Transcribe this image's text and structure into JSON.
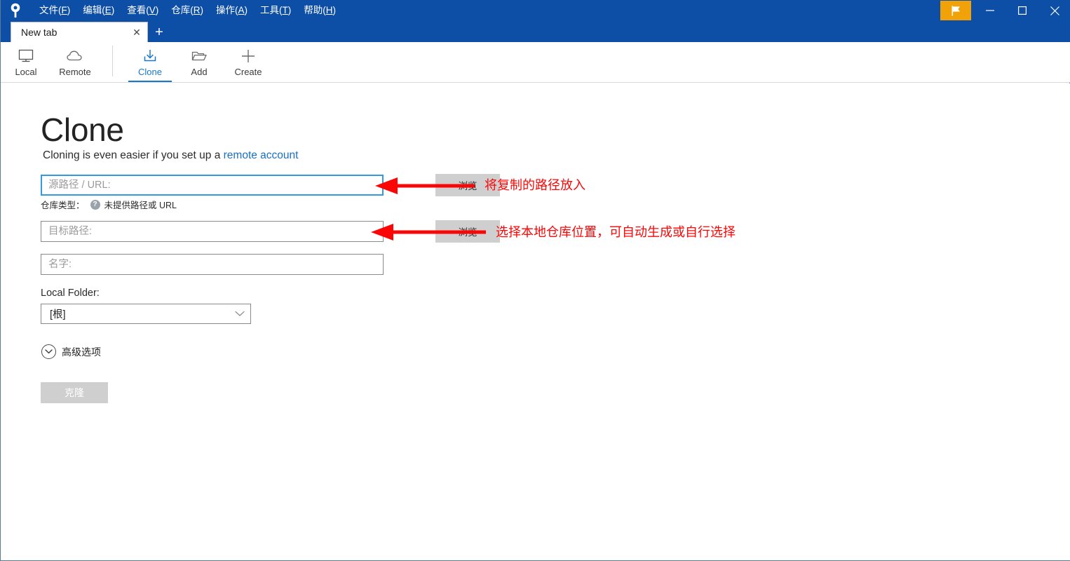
{
  "window": {
    "logo_icon": "sourcetree-logo-icon",
    "menus": [
      {
        "label": "文件",
        "accel": "F"
      },
      {
        "label": "编辑",
        "accel": "E"
      },
      {
        "label": "查看",
        "accel": "V"
      },
      {
        "label": "仓库",
        "accel": "R"
      },
      {
        "label": "操作",
        "accel": "A"
      },
      {
        "label": "工具",
        "accel": "T"
      },
      {
        "label": "帮助",
        "accel": "H"
      }
    ],
    "flag_button_icon": "flag-icon",
    "minimize_glyph": "—",
    "maximize_glyph": "☐",
    "close_glyph": "✕",
    "accent_blue": "#0d4ea6",
    "flag_orange": "#f0a208"
  },
  "tabs": {
    "items": [
      {
        "label": "New tab",
        "close_glyph": "✕"
      }
    ],
    "new_tab_glyph": "+"
  },
  "toolbar": {
    "groups": [
      {
        "items": [
          {
            "label": "Local",
            "icon": "monitor-icon",
            "active": false
          },
          {
            "label": "Remote",
            "icon": "cloud-icon",
            "active": false
          }
        ]
      },
      {
        "items": [
          {
            "label": "Clone",
            "icon": "clone-download-icon",
            "active": true
          },
          {
            "label": "Add",
            "icon": "folder-open-icon",
            "active": false
          },
          {
            "label": "Create",
            "icon": "plus-icon",
            "active": false
          }
        ]
      }
    ],
    "active_color": "#1878c8"
  },
  "main": {
    "title": "Clone",
    "subtitle_prefix": "Cloning is even easier if you set up a ",
    "subtitle_link": "remote account",
    "source_path": {
      "placeholder": "源路径 / URL:",
      "value": "",
      "browse_label": "浏览"
    },
    "repo_type": {
      "label": "仓库类型：",
      "help_glyph": "?",
      "status": "未提供路径或 URL"
    },
    "dest_path": {
      "placeholder": "目标路径:",
      "value": "",
      "browse_label": "浏览"
    },
    "name_field": {
      "placeholder": "名字:",
      "value": ""
    },
    "local_folder": {
      "label": "Local Folder:",
      "selected": "[根]",
      "chevron_glyph": "⌄"
    },
    "advanced": {
      "label": "高级选项",
      "chevron_glyph": "⌄"
    },
    "clone_button": {
      "label": "克隆",
      "enabled": false
    }
  },
  "annotations": {
    "color": "#fb0606",
    "items": [
      {
        "text": "将复制的路径放入"
      },
      {
        "text": "选择本地仓库位置，可自动生成或自行选择"
      }
    ]
  }
}
